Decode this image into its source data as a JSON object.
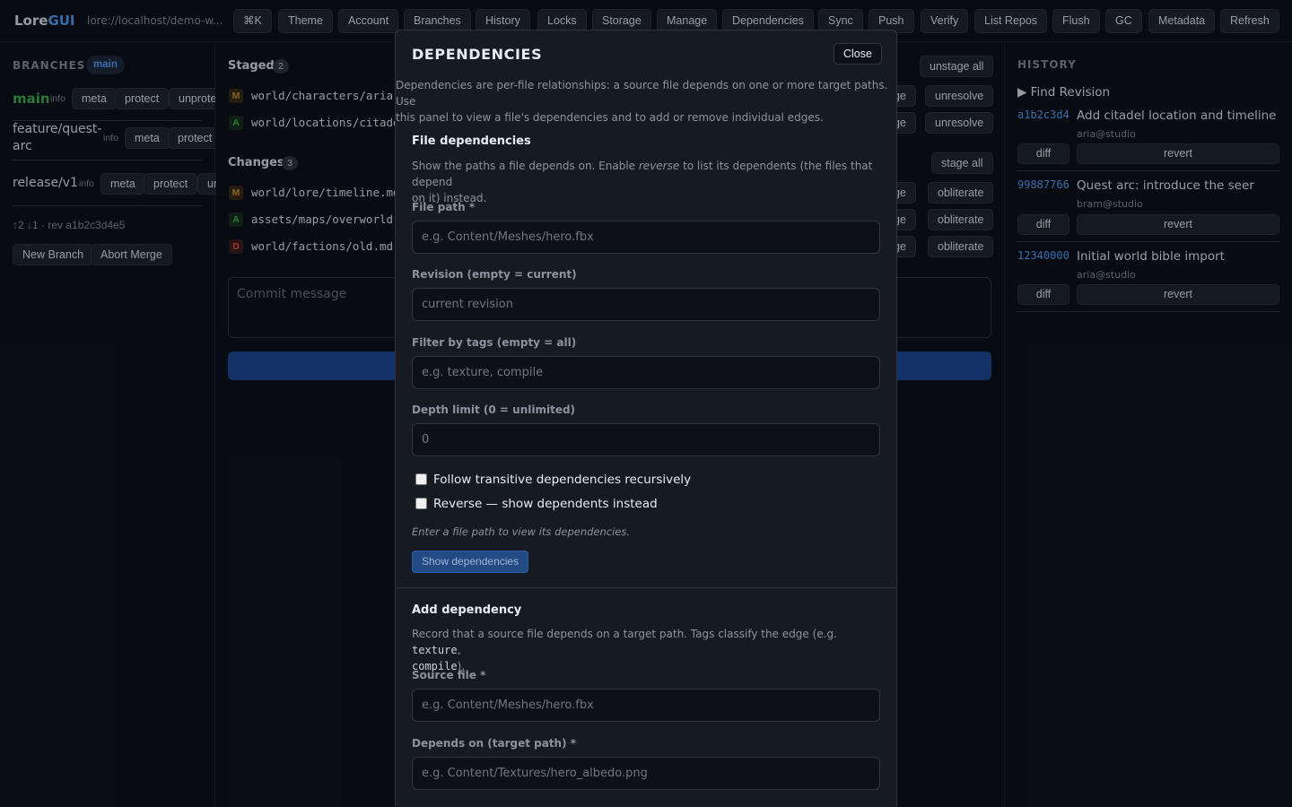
{
  "app": {
    "brand_lore": "Lore",
    "brand_gui": "GUI",
    "repo_url": "lore://localhost/demo-w..."
  },
  "toolbar": {
    "palette": "⌘K",
    "theme": "Theme",
    "account": "Account",
    "branches": "Branches",
    "history": "History",
    "locks": "Locks",
    "storage": "Storage",
    "manage": "Manage",
    "dependencies": "Dependencies",
    "sync": "Sync",
    "push": "Push",
    "verify": "Verify",
    "list_repos": "List Repos",
    "flush": "Flush",
    "gc": "GC",
    "metadata": "Metadata",
    "refresh": "Refresh"
  },
  "branches": {
    "title": "BRANCHES",
    "current": "main",
    "items": [
      {
        "name": "main",
        "info": "info",
        "meta": "meta",
        "protect": "protect",
        "unprotect": "unprote"
      },
      {
        "name_l1": "feature/quest-",
        "name_l2": "arc",
        "info": "info",
        "meta": "meta",
        "protect": "protect"
      },
      {
        "name": "release/v1",
        "info": "info",
        "meta": "meta",
        "protect": "protect",
        "extra": "ur"
      }
    ],
    "sync_status": "↑2 ↓1 · rev a1b2c3d4e5",
    "new_branch": "New Branch",
    "abort_merge": "Abort Merge"
  },
  "changes": {
    "staged_title": "Staged",
    "staged_count": "2",
    "unstage_all": "unstage all",
    "staged": [
      {
        "status": "M",
        "path": "world/characters/aria.",
        "tail": "ge",
        "action": "unresolve"
      },
      {
        "status": "A",
        "path": "world/locations/citade",
        "tail": "ge",
        "action": "unresolve"
      }
    ],
    "changes_title": "Changes",
    "changes_count": "3",
    "stage_all": "stage all",
    "files": [
      {
        "status": "M",
        "path": "world/lore/timeline.md",
        "tail": "ge",
        "action": "obliterate"
      },
      {
        "status": "A",
        "path": "assets/maps/overworld.",
        "tail": "ge",
        "action": "obliterate"
      },
      {
        "status": "D",
        "path": "world/factions/old.md",
        "tail": "ge",
        "action": "obliterate"
      }
    ],
    "commit_placeholder": "Commit message"
  },
  "history": {
    "title": "HISTORY",
    "find_revision": "▶ Find Revision",
    "diff": "diff",
    "revert": "revert",
    "commits": [
      {
        "hash": "a1b2c3d4",
        "message": "Add citadel location and timeline",
        "author": "aria@studio"
      },
      {
        "hash": "99887766",
        "message": "Quest arc: introduce the seer",
        "author": "bram@studio"
      },
      {
        "hash": "12340000",
        "message": "Initial world bible import",
        "author": "aria@studio"
      }
    ]
  },
  "modal": {
    "title": "DEPENDENCIES",
    "close": "Close",
    "intro_l1": "Dependencies are per-file relationships: a source file depends on one or more target paths. Use",
    "intro_l2": "this panel to view a file's dependencies and to add or remove individual edges.",
    "file_deps": {
      "heading": "File dependencies",
      "desc_l1_a": "Show the paths a file depends on. Enable ",
      "desc_l1_em": "reverse",
      "desc_l1_b": " to list its dependents (the files that depend",
      "desc_l2": "on it) instead.",
      "file_path_label": "File path *",
      "file_path_placeholder": "e.g. Content/Meshes/hero.fbx",
      "revision_label": "Revision (empty = current)",
      "revision_placeholder": "current revision",
      "tags_label": "Filter by tags (empty = all)",
      "tags_placeholder": "e.g. texture, compile",
      "depth_label": "Depth limit (0 = unlimited)",
      "depth_placeholder": "0",
      "transitive_label": "Follow transitive dependencies recursively",
      "reverse_label": "Reverse — show dependents instead",
      "hint": "Enter a file path to view its dependencies.",
      "show_button": "Show dependencies"
    },
    "add_dep": {
      "heading": "Add dependency",
      "desc_l1_a": "Record that a source file depends on a target path. Tags classify the edge (e.g. ",
      "desc_l1_code": "texture",
      "desc_l1_b": ",",
      "desc_l2_code": "compile",
      "desc_l2_b": ").",
      "source_label": "Source file *",
      "source_placeholder": "e.g. Content/Meshes/hero.fbx",
      "target_label": "Depends on (target path) *",
      "target_placeholder": "e.g. Content/Textures/hero_albedo.png"
    }
  }
}
